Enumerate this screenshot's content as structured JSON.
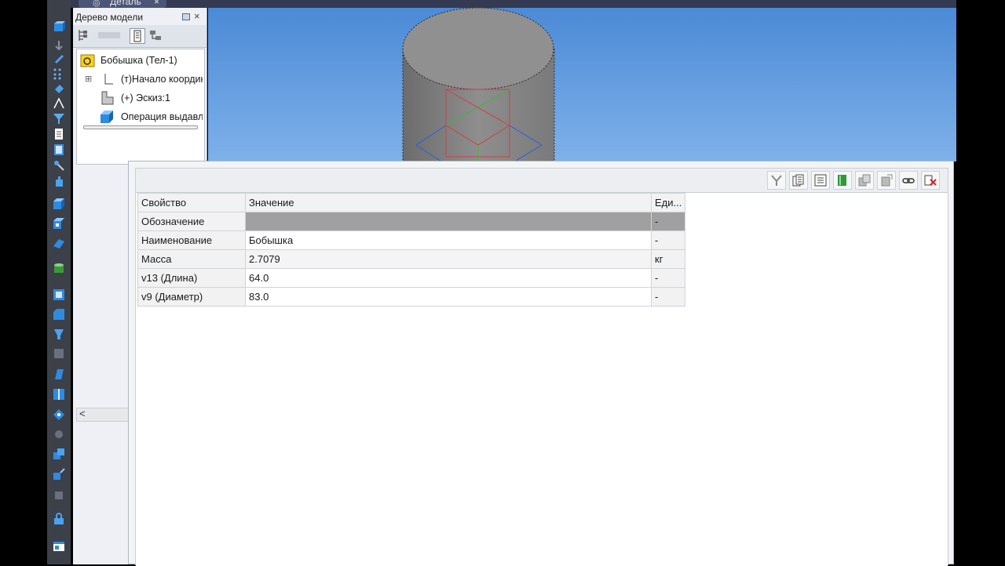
{
  "document_tab": {
    "label": "Деталь",
    "close": "×"
  },
  "tree": {
    "title": "Дерево модели",
    "close": "×",
    "items": [
      {
        "label": "Бобышка (Тел-1)"
      },
      {
        "label": "(т)Начало координат"
      },
      {
        "label": "(+) Эскиз:1"
      },
      {
        "label": "Операция выдавливания"
      }
    ],
    "expand_glyph": "⊞",
    "scroll_left": "<"
  },
  "properties": {
    "columns": [
      "Свойство",
      "Значение",
      "Еди..."
    ],
    "rows": [
      {
        "property": "Обозначение",
        "value": "",
        "unit": "-"
      },
      {
        "property": "Наименование",
        "value": "Бобышка",
        "unit": "-"
      },
      {
        "property": "Масса",
        "value": "2.7079",
        "unit": "кг"
      },
      {
        "property": "v13 (Длина)",
        "value": "64.0",
        "unit": "-"
      },
      {
        "property": "v9 (Диаметр)",
        "value": "83.0",
        "unit": "-"
      }
    ],
    "toolbar_icons": [
      "filter-icon",
      "copy-icon",
      "list-icon",
      "book-icon",
      "transfer-icon",
      "export-icon",
      "link-icon",
      "delete-icon"
    ]
  },
  "colors": {
    "viewport_top": "#4b8ad6",
    "viewport_bottom": "#7fb1ea",
    "selected_row": "#a0a0a0"
  }
}
